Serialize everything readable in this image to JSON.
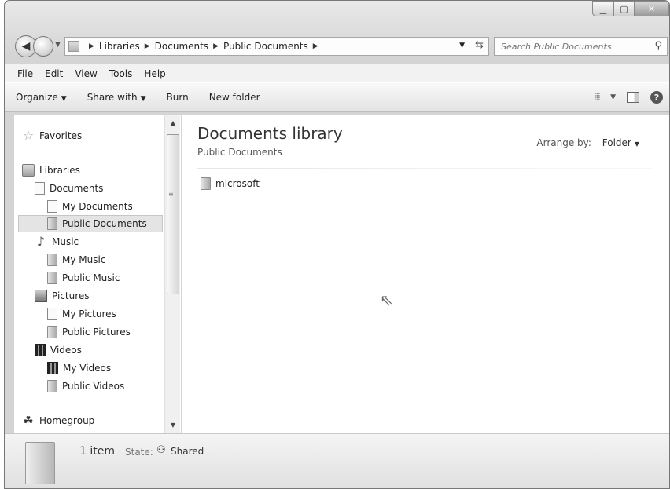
{
  "address": {
    "crumbs": [
      "Libraries",
      "Documents",
      "Public Documents"
    ],
    "search_placeholder": "Search Public Documents"
  },
  "menubar": {
    "items": [
      "File",
      "Edit",
      "View",
      "Tools",
      "Help"
    ]
  },
  "toolbar": {
    "organize": "Organize",
    "share_with": "Share with",
    "burn": "Burn",
    "new_folder": "New folder"
  },
  "nav": {
    "favorites": "Favorites",
    "libraries": "Libraries",
    "documents": "Documents",
    "my_documents": "My Documents",
    "public_documents": "Public Documents",
    "music": "Music",
    "my_music": "My Music",
    "public_music": "Public Music",
    "pictures": "Pictures",
    "my_pictures": "My Pictures",
    "public_pictures": "Public Pictures",
    "videos": "Videos",
    "my_videos": "My Videos",
    "public_videos": "Public Videos",
    "homegroup": "Homegroup"
  },
  "content": {
    "title": "Documents library",
    "subtitle": "Public Documents",
    "arrange_label": "Arrange by:",
    "arrange_value": "Folder",
    "files": [
      "microsoft"
    ]
  },
  "status": {
    "count": "1 item",
    "state_label": "State:",
    "state_value": "Shared"
  }
}
